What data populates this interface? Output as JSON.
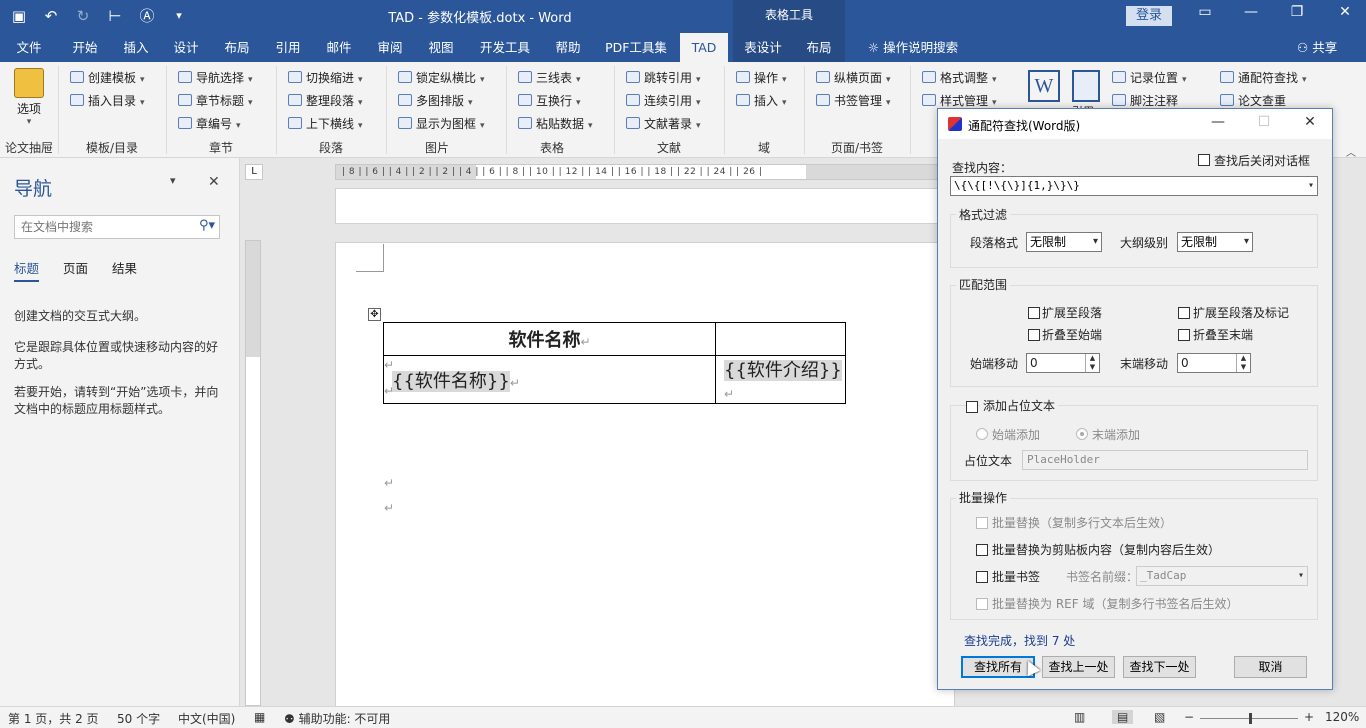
{
  "titlebar": {
    "doc_title": "TAD - 参数化模板.dotx  -  Word",
    "context_tools": "表格工具",
    "login": "登录",
    "qat_icons": [
      "save-icon",
      "undo-icon",
      "redo-icon",
      "format-icon",
      "touch-icon",
      "customize-icon"
    ]
  },
  "tabs": [
    {
      "label": "文件"
    },
    {
      "label": "开始"
    },
    {
      "label": "插入"
    },
    {
      "label": "设计"
    },
    {
      "label": "布局"
    },
    {
      "label": "引用"
    },
    {
      "label": "邮件"
    },
    {
      "label": "审阅"
    },
    {
      "label": "视图"
    },
    {
      "label": "开发工具"
    },
    {
      "label": "帮助"
    },
    {
      "label": "PDF工具集"
    },
    {
      "label": "TAD"
    },
    {
      "label": "表设计"
    },
    {
      "label": "布局"
    }
  ],
  "tell_me": "操作说明搜索",
  "share": "共享",
  "ribbon": {
    "options_label": "选项",
    "groups": {
      "g1": "论文抽屉",
      "g2": "模板/目录",
      "g3": "章节",
      "g4": "段落",
      "g5": "图片",
      "g6": "表格",
      "g7": "文献",
      "g8": "域",
      "g9": "页面/书签"
    },
    "items": {
      "create_template": "创建模板",
      "insert_toc": "插入目录",
      "nav_select": "导航选择",
      "chapter_title": "章节标题",
      "chapter_no": "章编号",
      "toggle_indent": "切换缩进",
      "tidy_para": "整理段落",
      "top_bottom_line": "上下横线",
      "lock_ratio": "锁定纵横比",
      "multi_layout": "多图排版",
      "show_frame": "显示为图框",
      "three_line": "三线表",
      "swap_row": "互换行",
      "paste_data": "粘贴数据",
      "jump_ref": "跳转引用",
      "cont_ref": "连续引用",
      "bib_entry": "文献著录",
      "op": "操作",
      "insert": "插入",
      "landscape": "纵横页面",
      "bookmark_mgr": "书签管理",
      "format_adjust": "格式调整",
      "style_mgr": "样式管理",
      "record_pos": "记录位置",
      "footnote": "脚注注释",
      "wildcard_find": "通配符查找",
      "paper_check": "论文查重",
      "ref_partial": "引用"
    }
  },
  "nav": {
    "title": "导航",
    "search_placeholder": "在文档中搜索",
    "tabs": [
      "标题",
      "页面",
      "结果"
    ],
    "text1": "创建文档的交互式大纲。",
    "text2": "它是跟踪具体位置或快速移动内容的好方式。",
    "text3": "若要开始，请转到“开始”选项卡，并向文档中的标题应用标题样式。"
  },
  "ruler": {
    "h_ticks": "| 8 |   | 6 |   | 4 |   | 2 |       | 2 |   | 4 |   | 6 |   | 8 |   | 10 |   | 12 |   | 14 |   | 16 |   | 18 |         | 22 |   | 24 |   | 26 |",
    "corner": "L"
  },
  "document": {
    "table": {
      "header": [
        "软件名称",
        ""
      ],
      "row": [
        "{{软件名称}}",
        "{{软件介绍}}"
      ]
    },
    "para_mark": "↵"
  },
  "status": {
    "page": "第 1 页，共 2 页",
    "words": "50 个字",
    "lang": "中文(中国)",
    "accessibility": "辅助功能: 不可用",
    "zoom": "120%"
  },
  "dialog": {
    "title": "通配符查找(Word版)",
    "find_label": "查找内容：",
    "close_after": "查找后关闭对话框",
    "find_value": "\\{\\{[!\\{\\}]{1,}\\}\\}",
    "format_filter": "格式过滤",
    "para_format_label": "段落格式",
    "para_format_value": "无限制",
    "outline_label": "大纲级别",
    "outline_value": "无限制",
    "match_range": "匹配范围",
    "extend_para": "扩展至段落",
    "extend_para_mark": "扩展至段落及标记",
    "collapse_start": "折叠至始端",
    "collapse_end": "折叠至末端",
    "start_move_label": "始端移动",
    "start_move_value": "0",
    "end_move_label": "末端移动",
    "end_move_value": "0",
    "add_placeholder": "添加占位文本",
    "add_start": "始端添加",
    "add_end": "末端添加",
    "placeholder_label": "占位文本",
    "placeholder_value": "PlaceHolder",
    "batch_ops": "批量操作",
    "batch_replace": "批量替换（复制多行文本后生效）",
    "batch_replace_clip": "批量替换为剪贴板内容（复制内容后生效）",
    "batch_bookmark": "批量书签",
    "bookmark_prefix_label": "书签名前缀：",
    "bookmark_prefix_value": "_TadCap",
    "batch_ref": "批量替换为 REF 域（复制多行书签名后生效）",
    "result": "查找完成，找到 7 处",
    "btn_find_all": "查找所有",
    "btn_find_prev": "查找上一处",
    "btn_find_next": "查找下一处",
    "btn_cancel": "取消"
  }
}
